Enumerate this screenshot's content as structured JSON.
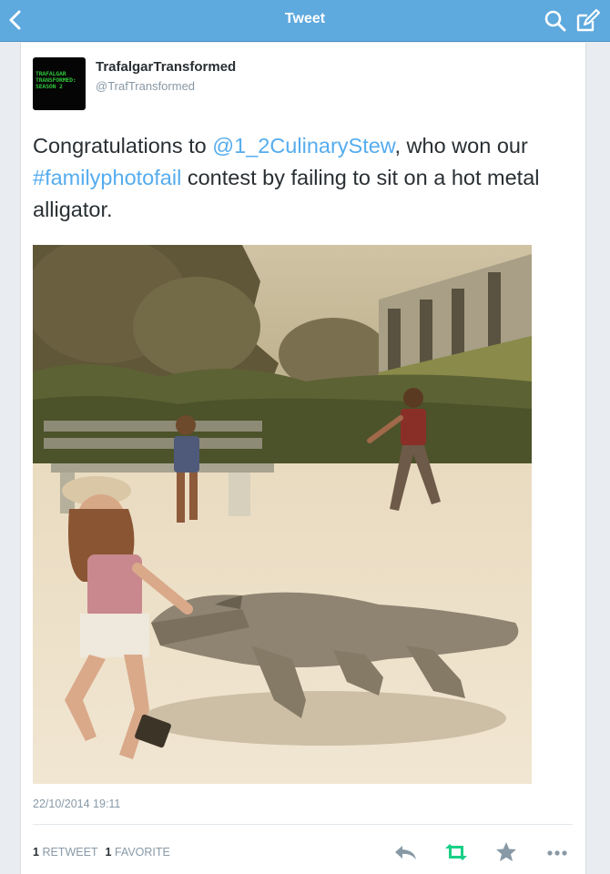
{
  "nav": {
    "title": "Tweet",
    "back_icon": "chevron-left-icon",
    "search_icon": "search-icon",
    "compose_icon": "compose-icon",
    "bar_color": "#5ea9dd"
  },
  "tweet": {
    "display_name": "TrafalgarTransformed",
    "screen_name": "@TrafTransformed",
    "avatar": {
      "lines": [
        "TRAFALGAR",
        "TRANSFORMED:",
        "SEASON 2"
      ],
      "text_color": "#2ec43a",
      "background": "#050505"
    },
    "text": {
      "part1": "Congratulations to ",
      "mention": "@1_2CulinaryStew",
      "part2": ", who won our ",
      "hashtag": "#familyphotofail",
      "part3": " contest by failing to sit on a hot metal alligator."
    },
    "link_color": "#55acee",
    "timestamp": "22/10/2014 19:11",
    "stats": {
      "retweet_count": "1",
      "retweet_label": "RETWEET",
      "favorite_count": "1",
      "favorite_label": "FAVORITE"
    },
    "actions": [
      "reply-icon",
      "retweet-icon",
      "favorite-star-icon",
      "more-dots-icon"
    ],
    "retweet_color": "#19cf86"
  }
}
